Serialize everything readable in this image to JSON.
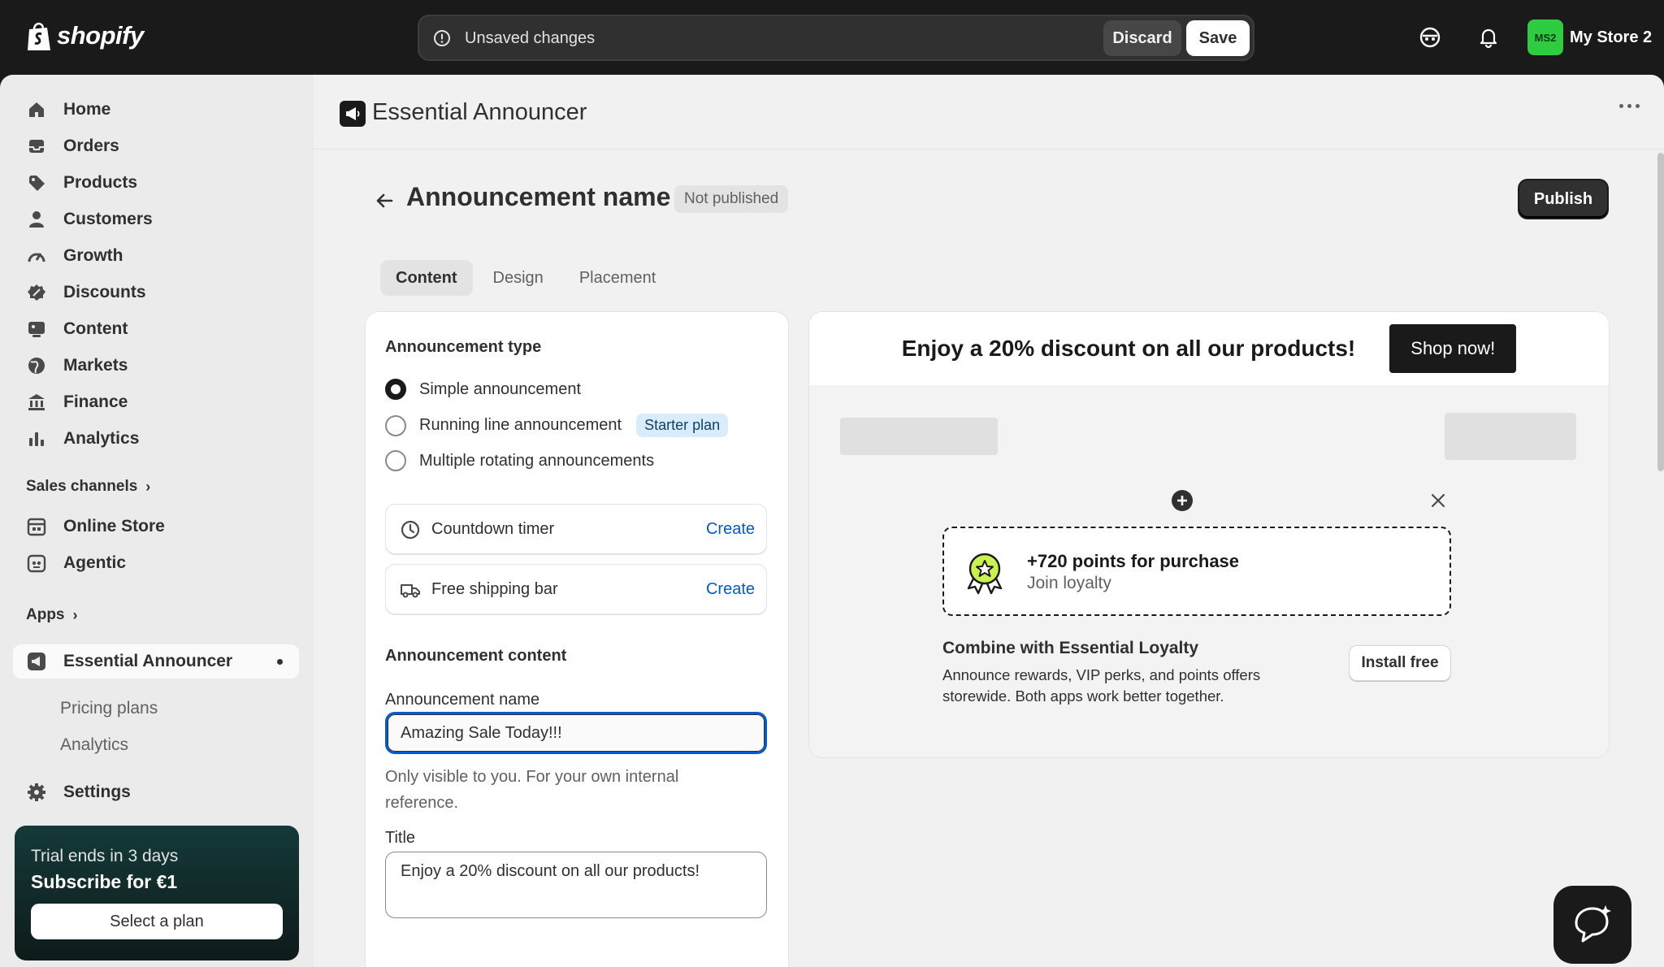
{
  "topbar": {
    "brand": "shopify",
    "savebar": {
      "message": "Unsaved changes",
      "discard": "Discard",
      "save": "Save"
    },
    "store": {
      "initials": "MS2",
      "name": "My Store 2"
    }
  },
  "sidebar": {
    "items": [
      {
        "label": "Home",
        "icon": "home-icon"
      },
      {
        "label": "Orders",
        "icon": "inbox-icon"
      },
      {
        "label": "Products",
        "icon": "tag-icon"
      },
      {
        "label": "Customers",
        "icon": "person-icon"
      },
      {
        "label": "Growth",
        "icon": "gauge-icon"
      },
      {
        "label": "Discounts",
        "icon": "discount-icon"
      },
      {
        "label": "Content",
        "icon": "content-icon"
      },
      {
        "label": "Markets",
        "icon": "globe-icon"
      },
      {
        "label": "Finance",
        "icon": "bank-icon"
      },
      {
        "label": "Analytics",
        "icon": "bar-chart-icon"
      }
    ],
    "sales_channels": "Sales channels",
    "channels": [
      {
        "label": "Online Store",
        "icon": "store-icon"
      },
      {
        "label": "Agentic",
        "icon": "agentic-icon"
      }
    ],
    "apps": "Apps",
    "app_active": "Essential Announcer",
    "app_sub": [
      "Pricing plans",
      "Analytics"
    ],
    "settings": "Settings",
    "trial": {
      "line1": "Trial ends in 3 days",
      "line2": "Subscribe for €1",
      "button": "Select a plan"
    }
  },
  "app_header": {
    "title": "Essential Announcer"
  },
  "page": {
    "title": "Announcement name",
    "status": "Not published",
    "publish": "Publish",
    "tabs": [
      "Content",
      "Design",
      "Placement"
    ]
  },
  "form": {
    "type_heading": "Announcement type",
    "types": [
      "Simple announcement",
      "Running line announcement",
      "Multiple rotating announcements"
    ],
    "starter_badge": "Starter plan",
    "tools": [
      {
        "label": "Countdown timer",
        "action": "Create"
      },
      {
        "label": "Free shipping bar",
        "action": "Create"
      }
    ],
    "content_heading": "Announcement content",
    "name_label": "Announcement name",
    "name_value": "Amazing Sale Today!!!",
    "name_help": "Only visible to you. For your own internal reference.",
    "title_label": "Title",
    "title_value": "Enjoy a 20% discount on all our products!"
  },
  "preview": {
    "banner_text": "Enjoy a 20% discount on all our products!",
    "banner_button": "Shop now!",
    "loyalty_points": "+720 points for purchase",
    "loyalty_join": "Join loyalty",
    "combine_title": "Combine with Essential Loyalty",
    "combine_desc": "Announce rewards, VIP perks, and points offers storewide. Both apps work better together.",
    "install": "Install free"
  }
}
